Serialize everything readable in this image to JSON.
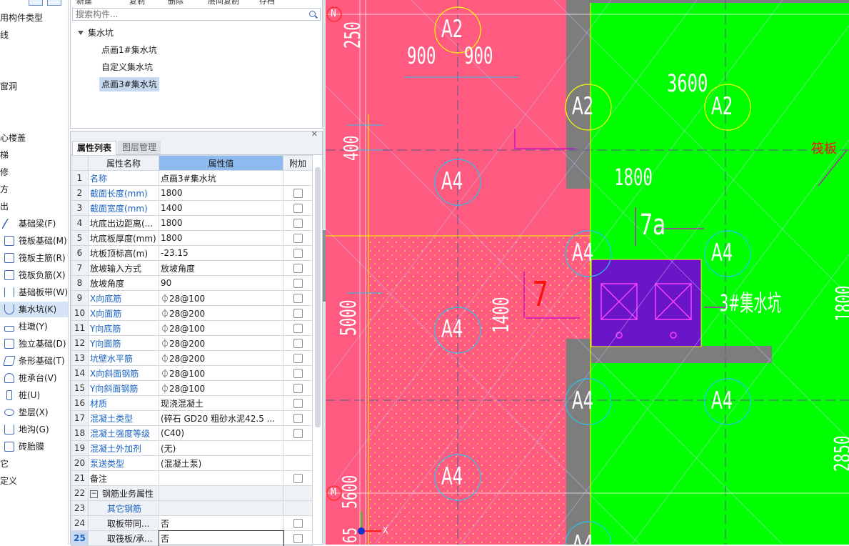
{
  "nav": {
    "partial_items": [
      "用构件类型",
      "线",
      "窗洞",
      "心楼盖",
      "梯",
      "修",
      "方",
      "出"
    ],
    "items": [
      {
        "label": "基础梁(F)",
        "icon": "beam-icon"
      },
      {
        "label": "筏板基础(M)",
        "icon": "raft-icon"
      },
      {
        "label": "筏板主筋(R)",
        "icon": "raft-main-rebar-icon"
      },
      {
        "label": "筏板负筋(X)",
        "icon": "raft-neg-rebar-icon"
      },
      {
        "label": "基础板带(W)",
        "icon": "slab-strip-icon"
      },
      {
        "label": "集水坑(K)",
        "icon": "sump-icon"
      },
      {
        "label": "柱墩(Y)",
        "icon": "column-pier-icon"
      },
      {
        "label": "独立基础(D)",
        "icon": "isolated-footing-icon"
      },
      {
        "label": "条形基础(T)",
        "icon": "strip-footing-icon"
      },
      {
        "label": "桩承台(V)",
        "icon": "pile-cap-icon"
      },
      {
        "label": "桩(U)",
        "icon": "pile-icon"
      },
      {
        "label": "垫层(X)",
        "icon": "cushion-icon"
      },
      {
        "label": "地沟(G)",
        "icon": "trench-icon"
      },
      {
        "label": "砖胎膜",
        "icon": "brick-mold-icon"
      }
    ],
    "bottom_partial": [
      "它",
      "定义"
    ],
    "selected_index": 5
  },
  "toolbar": {
    "new": "新建",
    "copy": "复制",
    "delete": "删除",
    "layer_copy": "层间复制",
    "save": "存档"
  },
  "search": {
    "placeholder": "搜索构件..."
  },
  "tree": {
    "root": "集水坑",
    "children": [
      "点画1#集水坑",
      "自定义集水坑",
      "点画3#集水坑"
    ],
    "selected_index": 2
  },
  "props": {
    "tabs": [
      "属性列表",
      "图层管理"
    ],
    "headers": {
      "name": "属性名称",
      "value": "属性值",
      "extra": "附加"
    },
    "rows": [
      {
        "n": "1",
        "name": "名称",
        "value": "点画3#集水坑",
        "blue": true,
        "check": false
      },
      {
        "n": "2",
        "name": "截面长度(mm)",
        "value": "1800",
        "blue": true,
        "check": true
      },
      {
        "n": "3",
        "name": "截面宽度(mm)",
        "value": "1400",
        "blue": true,
        "check": true
      },
      {
        "n": "4",
        "name": "坑底出边距离(...",
        "value": "1800",
        "blue": false,
        "check": true
      },
      {
        "n": "5",
        "name": "坑底板厚度(mm)",
        "value": "1800",
        "blue": false,
        "check": true
      },
      {
        "n": "6",
        "name": "坑板顶标高(m)",
        "value": "-23.15",
        "blue": false,
        "check": true
      },
      {
        "n": "7",
        "name": "放坡输入方式",
        "value": "放坡角度",
        "blue": false,
        "check": true
      },
      {
        "n": "8",
        "name": "放坡角度",
        "value": "90",
        "blue": false,
        "check": true
      },
      {
        "n": "9",
        "name": "X向底筋",
        "value": "⏀28@100",
        "blue": true,
        "check": true
      },
      {
        "n": "10",
        "name": "X向面筋",
        "value": "⏀28@200",
        "blue": true,
        "check": true
      },
      {
        "n": "11",
        "name": "Y向底筋",
        "value": "⏀28@100",
        "blue": true,
        "check": true
      },
      {
        "n": "12",
        "name": "Y向面筋",
        "value": "⏀28@200",
        "blue": true,
        "check": true
      },
      {
        "n": "13",
        "name": "坑壁水平筋",
        "value": "⏀28@200",
        "blue": true,
        "check": true
      },
      {
        "n": "14",
        "name": "X向斜面钢筋",
        "value": "⏀28@100",
        "blue": true,
        "check": true
      },
      {
        "n": "15",
        "name": "Y向斜面钢筋",
        "value": "⏀28@100",
        "blue": true,
        "check": true
      },
      {
        "n": "16",
        "name": "材质",
        "value": "现浇混凝土",
        "blue": true,
        "check": true
      },
      {
        "n": "17",
        "name": "混凝土类型",
        "value": "(碎石 GD20 粗砂水泥42.5 ...",
        "blue": true,
        "check": true
      },
      {
        "n": "18",
        "name": "混凝土强度等级",
        "value": "(C40)",
        "blue": true,
        "check": true
      },
      {
        "n": "19",
        "name": "混凝土外加剂",
        "value": "(无)",
        "blue": true,
        "check": false
      },
      {
        "n": "20",
        "name": "泵送类型",
        "value": "(混凝土泵)",
        "blue": true,
        "check": false
      },
      {
        "n": "21",
        "name": "备注",
        "value": "",
        "blue": false,
        "check": true
      },
      {
        "n": "22",
        "name": "钢筋业务属性",
        "value": "",
        "group": true,
        "check": false
      },
      {
        "n": "23",
        "name": "其它钢筋",
        "value": "",
        "sub": "blue",
        "check": false
      },
      {
        "n": "24",
        "name": "取板带同...",
        "value": "否",
        "sub": "plain",
        "check": true
      },
      {
        "n": "25",
        "name": "取筏板/承...",
        "value": "否",
        "sub": "plain",
        "check": true,
        "current": true
      }
    ]
  },
  "canvas": {
    "axis_labels": [
      "N",
      "M"
    ],
    "grid_tags": [
      "A2",
      "A2",
      "A2",
      "A4",
      "A4",
      "A4",
      "A4",
      "A4",
      "A4",
      "A4",
      "A4"
    ],
    "dims": [
      "250",
      "900",
      "900",
      "3600",
      "400",
      "1800",
      "7a",
      "7",
      "1400",
      "5000",
      "1800",
      "2850",
      "5600",
      "65"
    ],
    "sump_label": "3#集水坑",
    "raft_label": "筏板",
    "axis_x": "X",
    "colors": {
      "pink": "#ff5a80",
      "green": "#00ff00",
      "purple": "#6a16c8",
      "gray": "#7d7d7d",
      "yellow": "#ffff00",
      "magenta": "#d000d0",
      "cyan": "#26c6f0"
    }
  }
}
